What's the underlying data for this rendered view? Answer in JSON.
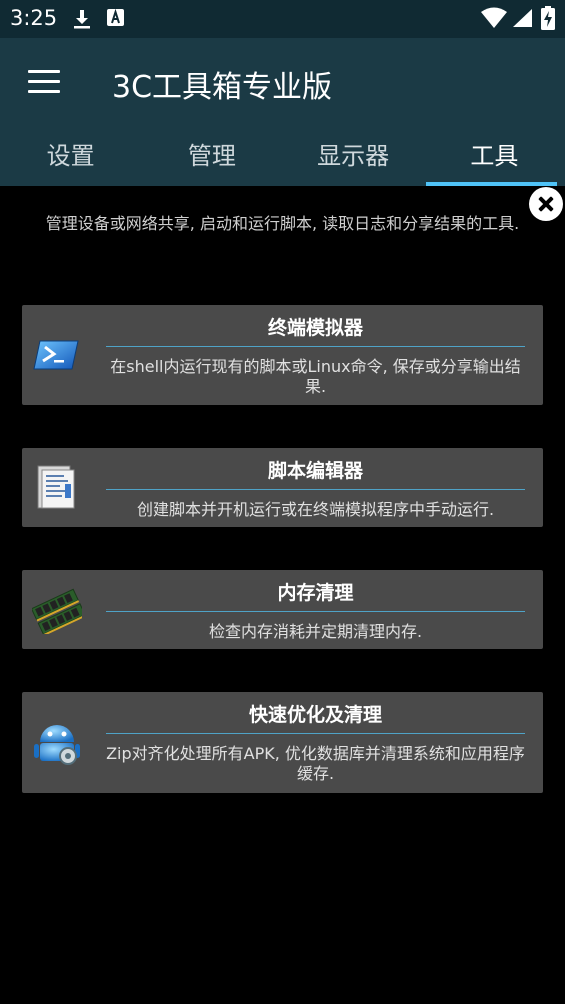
{
  "status_bar": {
    "time": "3:25",
    "icons": [
      "download-icon",
      "accessibility-icon",
      "wifi-icon",
      "cell-signal-icon",
      "battery-charging-icon"
    ]
  },
  "app_bar": {
    "title": "3C工具箱专业版",
    "menu_icon": "hamburger-menu-icon"
  },
  "tabs": [
    {
      "label": "设置",
      "active": false
    },
    {
      "label": "管理",
      "active": false
    },
    {
      "label": "显示器",
      "active": false
    },
    {
      "label": "工具",
      "active": true
    }
  ],
  "description": "管理设备或网络共享, 启动和运行脚本, 读取日志和分享结果的工具.",
  "close_icon": "close-icon",
  "tools": [
    {
      "title": "终端模拟器",
      "text": "在shell内运行现有的脚本或Linux命令, 保存或分享输出结果.",
      "icon": "terminal-icon"
    },
    {
      "title": "脚本编辑器",
      "text": "创建脚本并开机运行或在终端模拟程序中手动运行.",
      "icon": "script-editor-icon"
    },
    {
      "title": "内存清理",
      "text": "检查内存消耗并定期清理内存.",
      "icon": "memory-ram-icon"
    },
    {
      "title": "快速优化及清理",
      "text": "Zip对齐化处理所有APK, 优化数据库并清理系统和应用程序缓存.",
      "icon": "android-optimize-icon"
    }
  ],
  "colors": {
    "status_bar": "#102a33",
    "app_bar": "#1b3a45",
    "tab_indicator": "#4fc3f7",
    "card_bg": "#4a4a4a",
    "divider": "#4fa3c7"
  }
}
